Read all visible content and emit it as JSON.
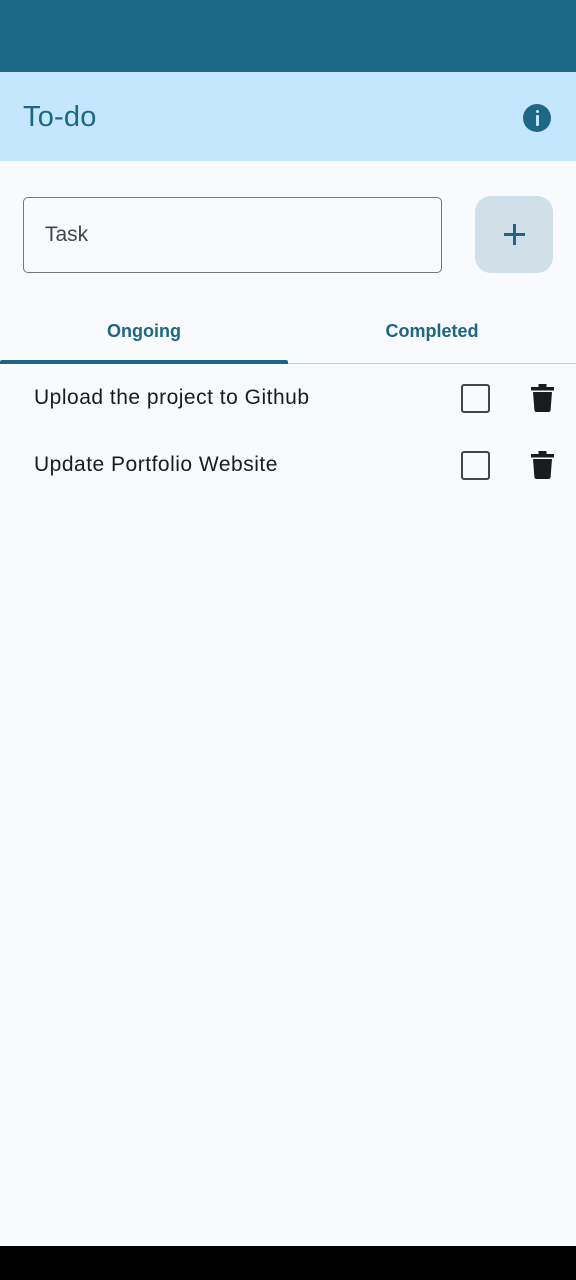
{
  "app": {
    "title": "To-do"
  },
  "input": {
    "placeholder": "Task",
    "value": ""
  },
  "tabs": [
    {
      "label": "Ongoing",
      "selected": true
    },
    {
      "label": "Completed",
      "selected": false
    }
  ],
  "tasks": [
    {
      "text": "Upload the project to Github",
      "checked": false
    },
    {
      "text": "Update Portfolio Website",
      "checked": false
    }
  ],
  "icons": {
    "info": "info-icon",
    "add": "plus-icon",
    "delete": "trash-icon"
  },
  "colors": {
    "status_bar": "#1c6686",
    "app_bar": "#c5e7fe",
    "accent": "#1c6686",
    "add_button": "#d0dfe8",
    "background": "#f8fafd",
    "text": "#191c1e"
  }
}
